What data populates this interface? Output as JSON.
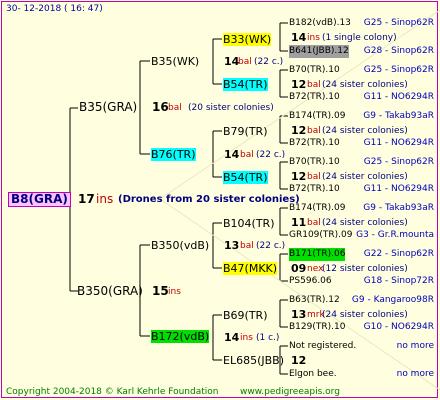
{
  "header": {
    "date": "30-  12-2018  (  16:  47)"
  },
  "footer": {
    "copyright": "Copyright 2004-2018 © Karl Kehrle Foundation",
    "url": "www.pedigreeapis.org"
  },
  "root": {
    "name": "B8(GRA)",
    "count": "17",
    "mark": "ins",
    "note": "(Drones from 20 sister colonies)"
  },
  "gen1": [
    {
      "name": "B35(GRA)",
      "count": "16",
      "mark": "bal",
      "note": "(20 sister colonies)"
    },
    {
      "name": "B350(GRA)",
      "count": "15",
      "mark": "ins",
      "note": ""
    }
  ],
  "gen2": [
    {
      "name": "B35(WK)"
    },
    {
      "name": "B76(TR)",
      "count": "14",
      "mark": "bal",
      "note": "(22 c.)"
    },
    {
      "name": "B350(vdB)",
      "count": "13",
      "mark": "bal",
      "note": "(22 c.)"
    },
    {
      "name": "B172(vdB)",
      "count": "14",
      "mark": "ins",
      "note": "(1 c.)"
    }
  ],
  "gen3": [
    {
      "name": "B33(WK)",
      "count": "14",
      "mark": "bal",
      "note": "(22 c.)"
    },
    {
      "name": "B54(TR)"
    },
    {
      "name": "B79(TR)",
      "count": "14",
      "mark": "bal",
      "note": "(22 c.)"
    },
    {
      "name": "B54(TR)"
    },
    {
      "name": "B104(TR)",
      "count": "13",
      "mark": "bal",
      "note": "(22 c.)"
    },
    {
      "name": "B47(MKK)"
    },
    {
      "name": "B69(TR)",
      "count": "14",
      "mark": "ins",
      "note": "(1 c.)"
    },
    {
      "name": "EL685(JBB)"
    }
  ],
  "gen4": [
    {
      "name": "B182(vdB).13",
      "info": "G25 - Sinop62R"
    },
    {
      "count": "14",
      "mark": "ins",
      "note": "(1 single colony)"
    },
    {
      "name": "B641(JBB).12",
      "info": "G28 - Sinop62R"
    },
    {
      "name": "B70(TR).10",
      "info": "G25 - Sinop62R"
    },
    {
      "count": "12",
      "mark": "bal",
      "note": "(24 sister colonies)"
    },
    {
      "name": "B72(TR).10",
      "info": "G11 - NO6294R"
    },
    {
      "name": "B174(TR).09",
      "info": "G9 - Takab93aR"
    },
    {
      "count": "12",
      "mark": "bal",
      "note": "(24 sister colonies)"
    },
    {
      "name": "B72(TR).10",
      "info": "G11 - NO6294R"
    },
    {
      "name": "B70(TR).10",
      "info": "G25 - Sinop62R"
    },
    {
      "count": "12",
      "mark": "bal",
      "note": "(24 sister colonies)"
    },
    {
      "name": "B72(TR).10",
      "info": "G11 - NO6294R"
    },
    {
      "name": "B174(TR).09",
      "info": "G9 - Takab93aR"
    },
    {
      "count": "11",
      "mark": "bal",
      "note": "(24 sister colonies)"
    },
    {
      "name": "GR109(TR).09",
      "info": "G3 - Gr.R.mounta"
    },
    {
      "name": "B171(TR).06",
      "info": "G22 - Sinop62R"
    },
    {
      "count": "09",
      "mark": "nex",
      "note": "(12 sister colonies)"
    },
    {
      "name": "PS596.06",
      "info": "G18 - Sinop72R"
    },
    {
      "name": "B63(TR).12",
      "info": "G9 - Kangaroo98R"
    },
    {
      "count": "13",
      "mark": "mrk",
      "note": "(24 sister colonies)"
    },
    {
      "name": "B129(TR).10",
      "info": "G10 - NO6294R"
    },
    {
      "name": "Not registered.",
      "info": "no more"
    },
    {
      "count": "12",
      "mark": "",
      "note": ""
    },
    {
      "name": "Elgon bee.",
      "info": "no more"
    }
  ]
}
